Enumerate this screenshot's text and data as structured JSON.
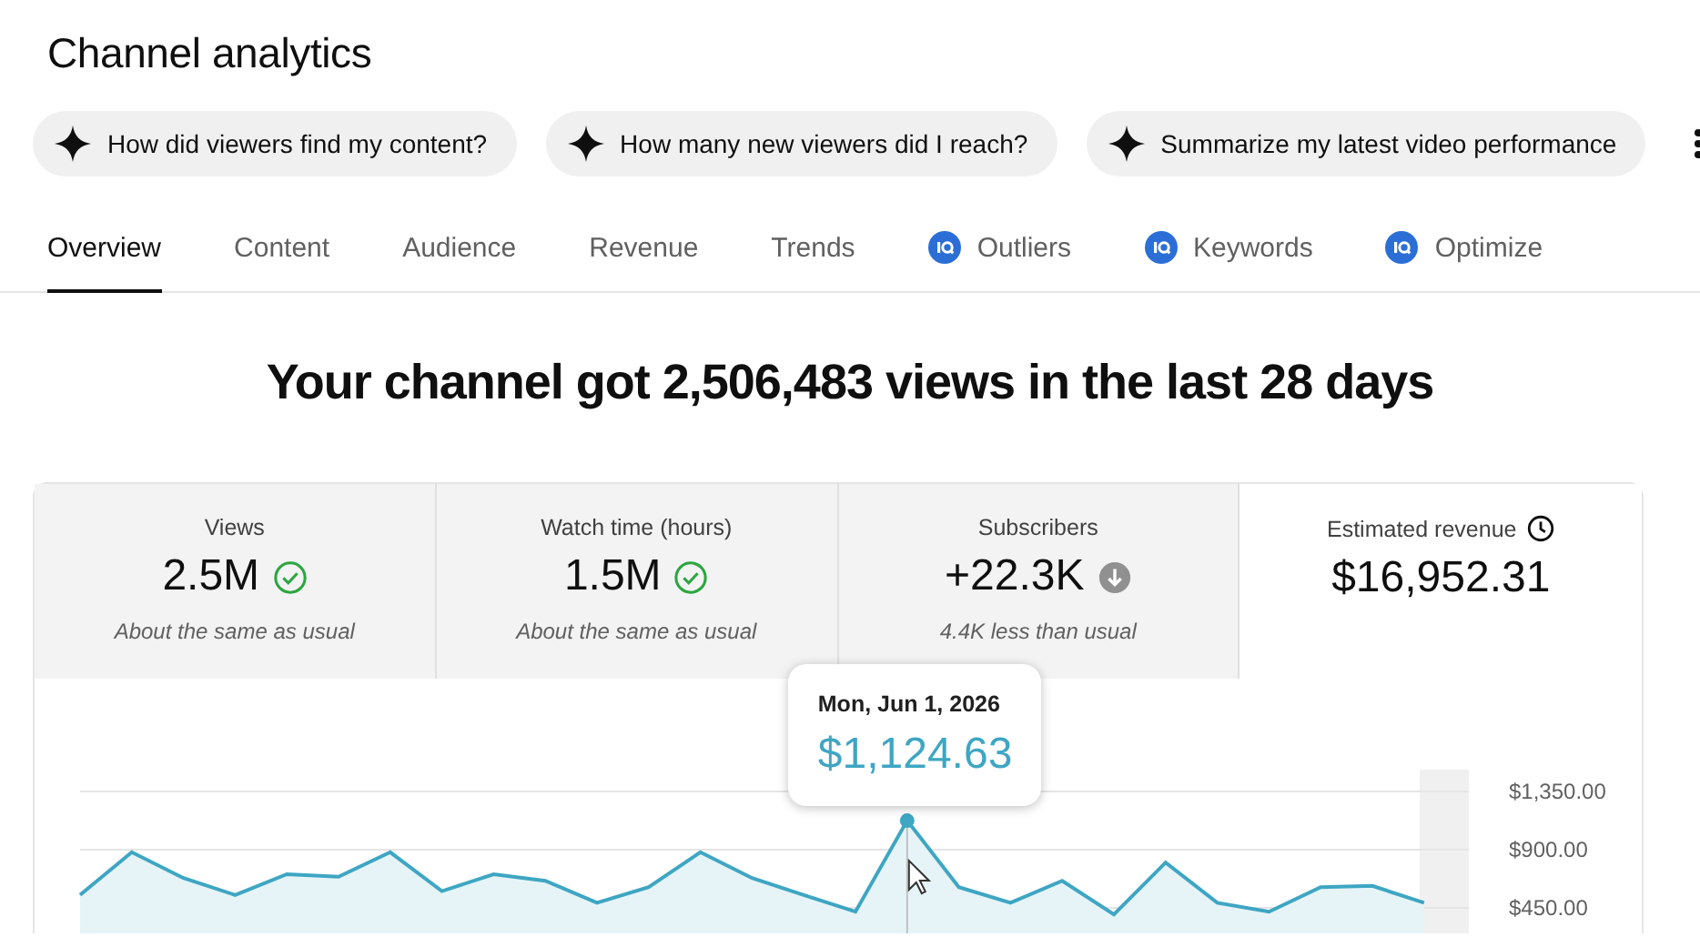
{
  "title": "Channel analytics",
  "suggestions": [
    {
      "label": "How did viewers find my content?"
    },
    {
      "label": "How many new viewers did I reach?"
    },
    {
      "label": "Summarize my latest video performance"
    }
  ],
  "tabs": [
    {
      "label": "Overview",
      "selected": true,
      "kind": "plain"
    },
    {
      "label": "Content",
      "selected": false,
      "kind": "plain"
    },
    {
      "label": "Audience",
      "selected": false,
      "kind": "plain"
    },
    {
      "label": "Revenue",
      "selected": false,
      "kind": "plain"
    },
    {
      "label": "Trends",
      "selected": false,
      "kind": "plain"
    },
    {
      "label": "Outliers",
      "selected": false,
      "kind": "extension"
    },
    {
      "label": "Keywords",
      "selected": false,
      "kind": "extension"
    },
    {
      "label": "Optimize",
      "selected": false,
      "kind": "extension"
    }
  ],
  "headline": "Your channel got 2,506,483 views in the last 28 days",
  "metrics": [
    {
      "label": "Views",
      "value": "2.5M",
      "kind": "usual",
      "note": "About the same as usual",
      "selected": false
    },
    {
      "label": "Watch time (hours)",
      "value": "1.5M",
      "kind": "usual",
      "note": "About the same as usual",
      "selected": false
    },
    {
      "label": "Subscribers",
      "value": "+22.3K",
      "kind": "down",
      "note": "4.4K less than usual",
      "selected": false
    },
    {
      "label": "Estimated revenue",
      "value": "$16,952.31",
      "kind": "pending",
      "selected": true
    }
  ],
  "chart": {
    "tooltip": {
      "date": "Mon, Jun 1, 2026",
      "value": "$1,124.63"
    },
    "chart_data": {
      "type": "area",
      "ylim": [
        0,
        1350
      ],
      "yticks": [
        {
          "value": 450,
          "label": "$450.00"
        },
        {
          "value": 900,
          "label": "$900.00"
        },
        {
          "value": 1350,
          "label": "$1,350.00"
        }
      ],
      "series": [
        {
          "color": "#3ea6c3",
          "values": [
            550,
            880,
            680,
            550,
            710,
            690,
            880,
            580,
            710,
            660,
            490,
            610,
            880,
            680,
            550,
            420,
            1124.63,
            610,
            490,
            660,
            400,
            800,
            490,
            420,
            610,
            620,
            490
          ]
        }
      ]
    }
  }
}
